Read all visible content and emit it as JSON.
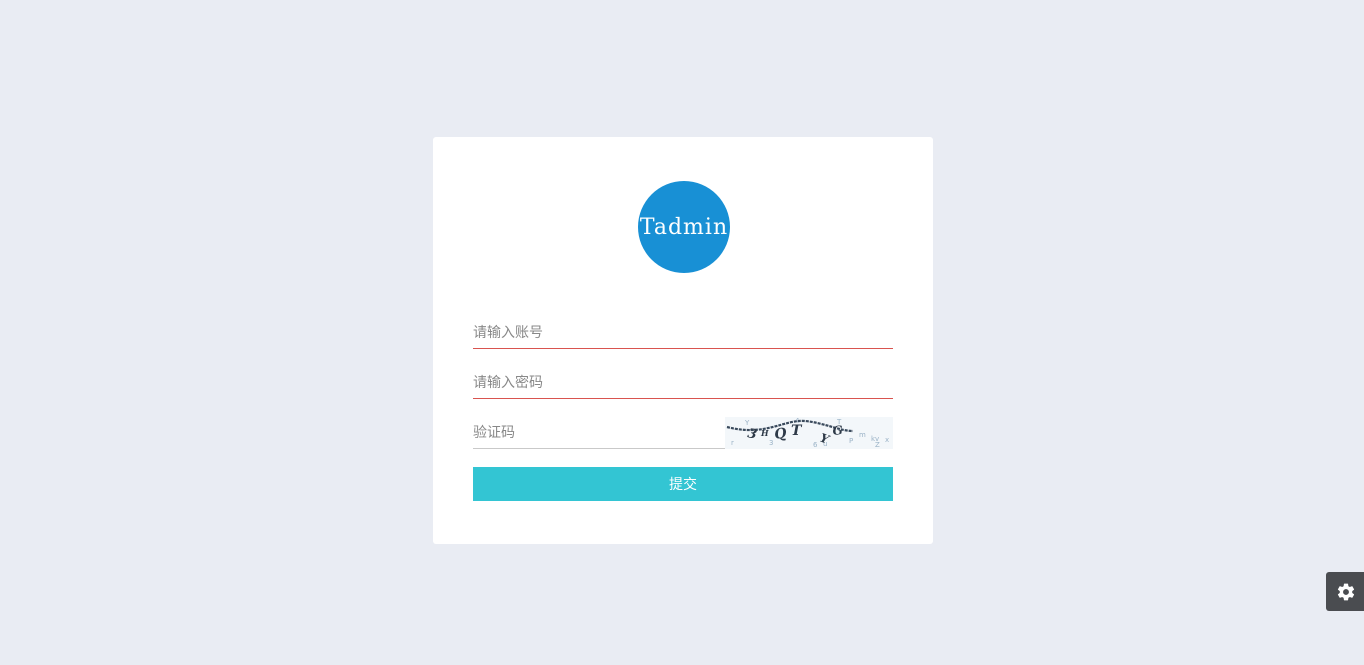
{
  "logo": {
    "text": "Tadmin",
    "color": "#1890d5"
  },
  "form": {
    "account_placeholder": "请输入账号",
    "password_placeholder": "请输入密码",
    "captcha_placeholder": "验证码",
    "captcha_text": "3HQT-YG",
    "submit_label": "提交"
  },
  "colors": {
    "background": "#e9ecf3",
    "card": "#ffffff",
    "submit": "#33c5d3",
    "error_underline": "#d9534f"
  },
  "settings": {
    "icon": "gear-icon"
  }
}
